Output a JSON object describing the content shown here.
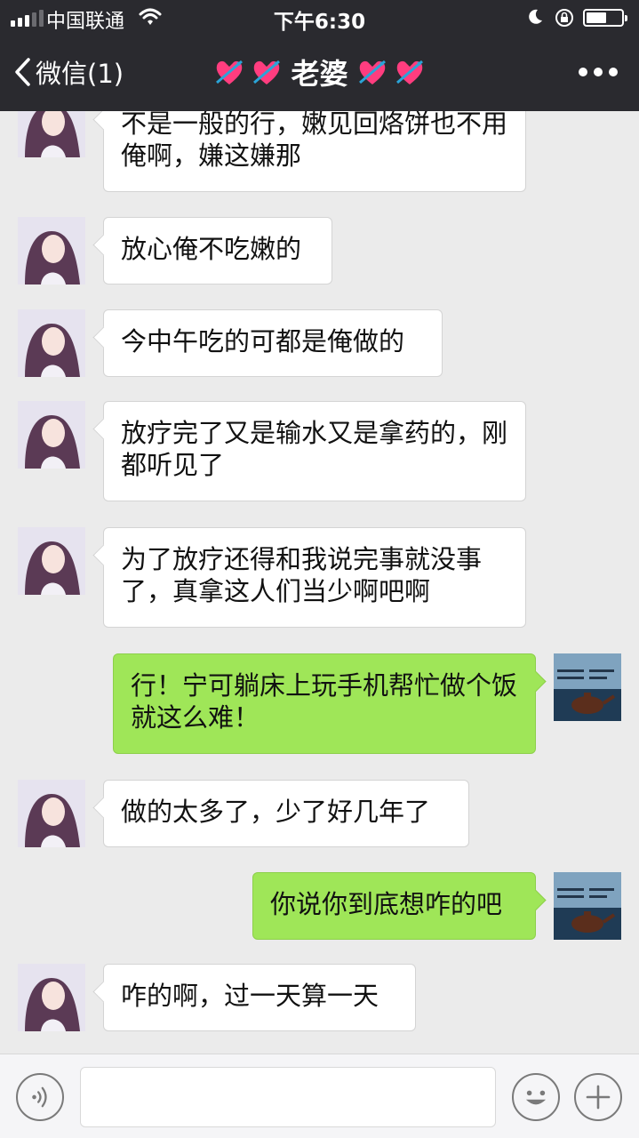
{
  "status_bar": {
    "carrier": "中国联通",
    "time": "下午6:30"
  },
  "nav": {
    "back_label": "微信(1)",
    "title": "老婆"
  },
  "messages": [
    {
      "side": "in",
      "text": "不是一般的行，嫩见回烙饼也不用俺啊，嫌这嫌那"
    },
    {
      "side": "in",
      "text": "放心俺不吃嫩的"
    },
    {
      "side": "in",
      "text": "今中午吃的可都是俺做的"
    },
    {
      "side": "in",
      "text": "放疗完了又是输水又是拿药的，刚都听见了"
    },
    {
      "side": "in",
      "text": "为了放疗还得和我说完事就没事了，真拿这人们当少啊吧啊"
    },
    {
      "side": "out",
      "text": "行！宁可躺床上玩手机帮忙做个饭就这么难！"
    },
    {
      "side": "in",
      "text": "做的太多了，少了好几年了"
    },
    {
      "side": "out",
      "text": "你说你到底想咋的吧"
    },
    {
      "side": "in",
      "text": "咋的啊，过一天算一天"
    }
  ],
  "theme": {
    "header_bg": "#2a2a2f",
    "chat_bg": "#ebebeb",
    "outgoing_bubble": "#9fe658",
    "incoming_bubble": "#ffffff"
  },
  "icons": {
    "back": "chevron-left-icon",
    "title_decoration": "heart-with-arrow-icon",
    "more": "more-dots-icon",
    "voice": "voice-icon",
    "emoji": "emoji-icon",
    "plus": "plus-icon"
  }
}
